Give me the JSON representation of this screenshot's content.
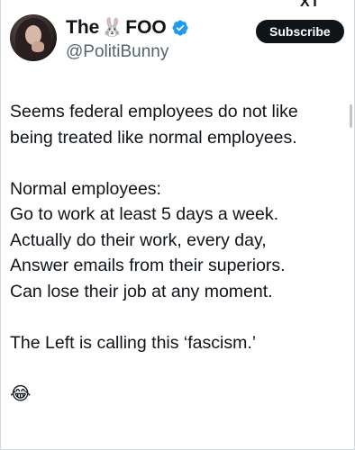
{
  "header": {
    "top_fragment": "XT",
    "display_name_prefix": "The",
    "display_name_emoji": "🐰",
    "display_name_suffix": "FOO",
    "handle": "@PolitiBunny",
    "subscribe_label": "Subscribe"
  },
  "tweet": {
    "lines": [
      "Seems federal employees do not like",
      "being treated like normal employees.",
      "",
      "Normal employees:",
      "Go to work at least 5 days a week.",
      "Actually do their work, every day,",
      "Answer emails from their superiors.",
      "Can lose their job at any moment.",
      "",
      "The Left is calling this ‘fascism.’",
      "",
      "😂"
    ]
  },
  "colors": {
    "text": "#0f1419",
    "secondary": "#536471",
    "verified": "#1d9bf0",
    "button_bg": "#0f1419"
  },
  "icons": {
    "verified": "verified-badge-icon",
    "avatar": "profile-photo"
  }
}
